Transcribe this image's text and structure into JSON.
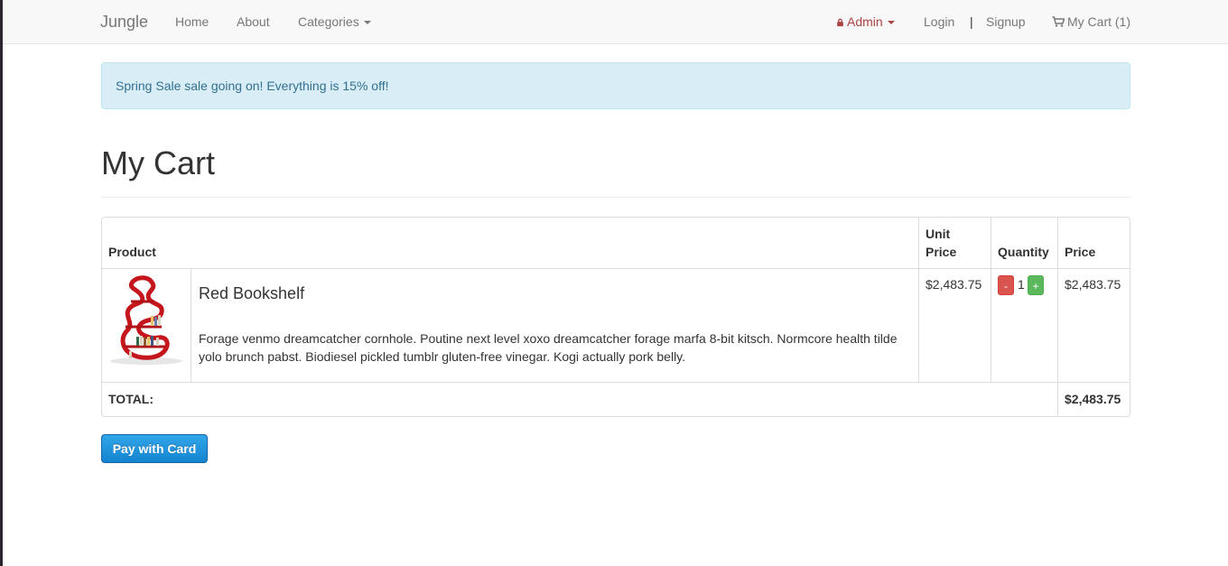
{
  "navbar": {
    "brand": "Jungle",
    "links": {
      "home": "Home",
      "about": "About",
      "categories": "Categories"
    },
    "right": {
      "admin": "Admin",
      "login": "Login",
      "separator": "|",
      "signup": "Signup",
      "cart": "My Cart (1)"
    },
    "icons": {
      "admin": "lock-icon",
      "cart": "shopping-cart-icon",
      "dropdown": "caret-down-icon"
    }
  },
  "alert": {
    "text": "Spring Sale sale going on! Everything is 15% off!"
  },
  "page": {
    "title": "My Cart"
  },
  "cart": {
    "headers": {
      "product": "Product",
      "unit_price_line1": "Unit",
      "unit_price_line2": "Price",
      "quantity": "Quantity",
      "price": "Price"
    },
    "items": [
      {
        "name": "Red Bookshelf",
        "description": "Forage venmo dreamcatcher cornhole. Poutine next level xoxo dreamcatcher forage marfa 8-bit kitsch. Normcore health tilde yolo brunch pabst. Biodiesel pickled tumblr gluten-free vinegar. Kogi actually pork belly.",
        "unit_price": "$2,483.75",
        "quantity": "1",
        "decrease_label": "-",
        "increase_label": "+",
        "price": "$2,483.75"
      }
    ],
    "total_label": "TOTAL:",
    "total": "$2,483.75"
  },
  "checkout": {
    "button_label": "Pay with Card"
  },
  "colors": {
    "alert_background": "#d9edf7",
    "alert_text": "#31708f",
    "admin": "#a94442",
    "decrease_button": "#d9534f",
    "increase_button": "#5cb85c",
    "pay_button": "#1a8ad9"
  }
}
